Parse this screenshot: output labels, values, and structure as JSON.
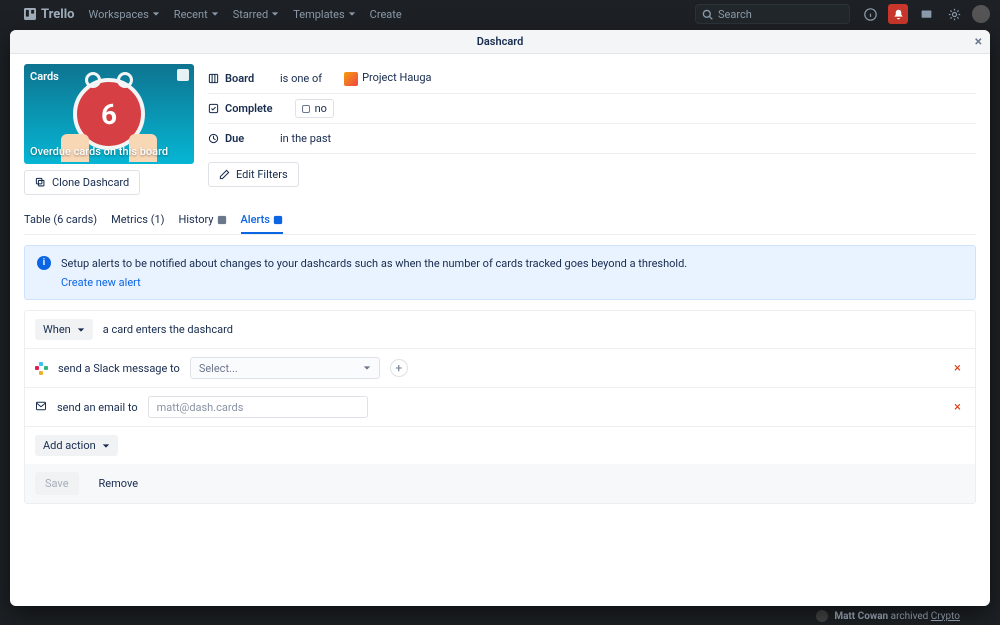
{
  "nav": {
    "brand": "Trello",
    "items": [
      "Workspaces",
      "Recent",
      "Starred",
      "Templates"
    ],
    "create": "Create",
    "search_placeholder": "Search"
  },
  "modal": {
    "title": "Dashcard"
  },
  "preview": {
    "badge": "Cards",
    "clock_number": "6",
    "title": "Overdue cards on this board"
  },
  "clone_label": "Clone Dashcard",
  "filters": {
    "board": {
      "label": "Board",
      "relation": "is one of",
      "project": "Project Hauga"
    },
    "complete": {
      "label": "Complete",
      "value": "no"
    },
    "due": {
      "label": "Due",
      "value": "in the past"
    },
    "edit_label": "Edit Filters"
  },
  "tabs": {
    "table": "Table (6 cards)",
    "metrics": "Metrics (1)",
    "history": "History",
    "alerts": "Alerts"
  },
  "banner": {
    "text": "Setup alerts to be notified about changes to your dashcards such as when the number of cards tracked goes beyond a threshold.",
    "link": "Create new alert"
  },
  "alert": {
    "when_label": "When",
    "when_text": "a card enters the dashcard",
    "slack_label": "send a Slack message to",
    "slack_placeholder": "Select...",
    "email_label": "send an email to",
    "email_placeholder": "matt@dash.cards",
    "add_action": "Add action",
    "save": "Save",
    "remove": "Remove"
  },
  "bg_feed": {
    "user": "Matt Cowan",
    "action": "archived",
    "target": "Crypto"
  }
}
